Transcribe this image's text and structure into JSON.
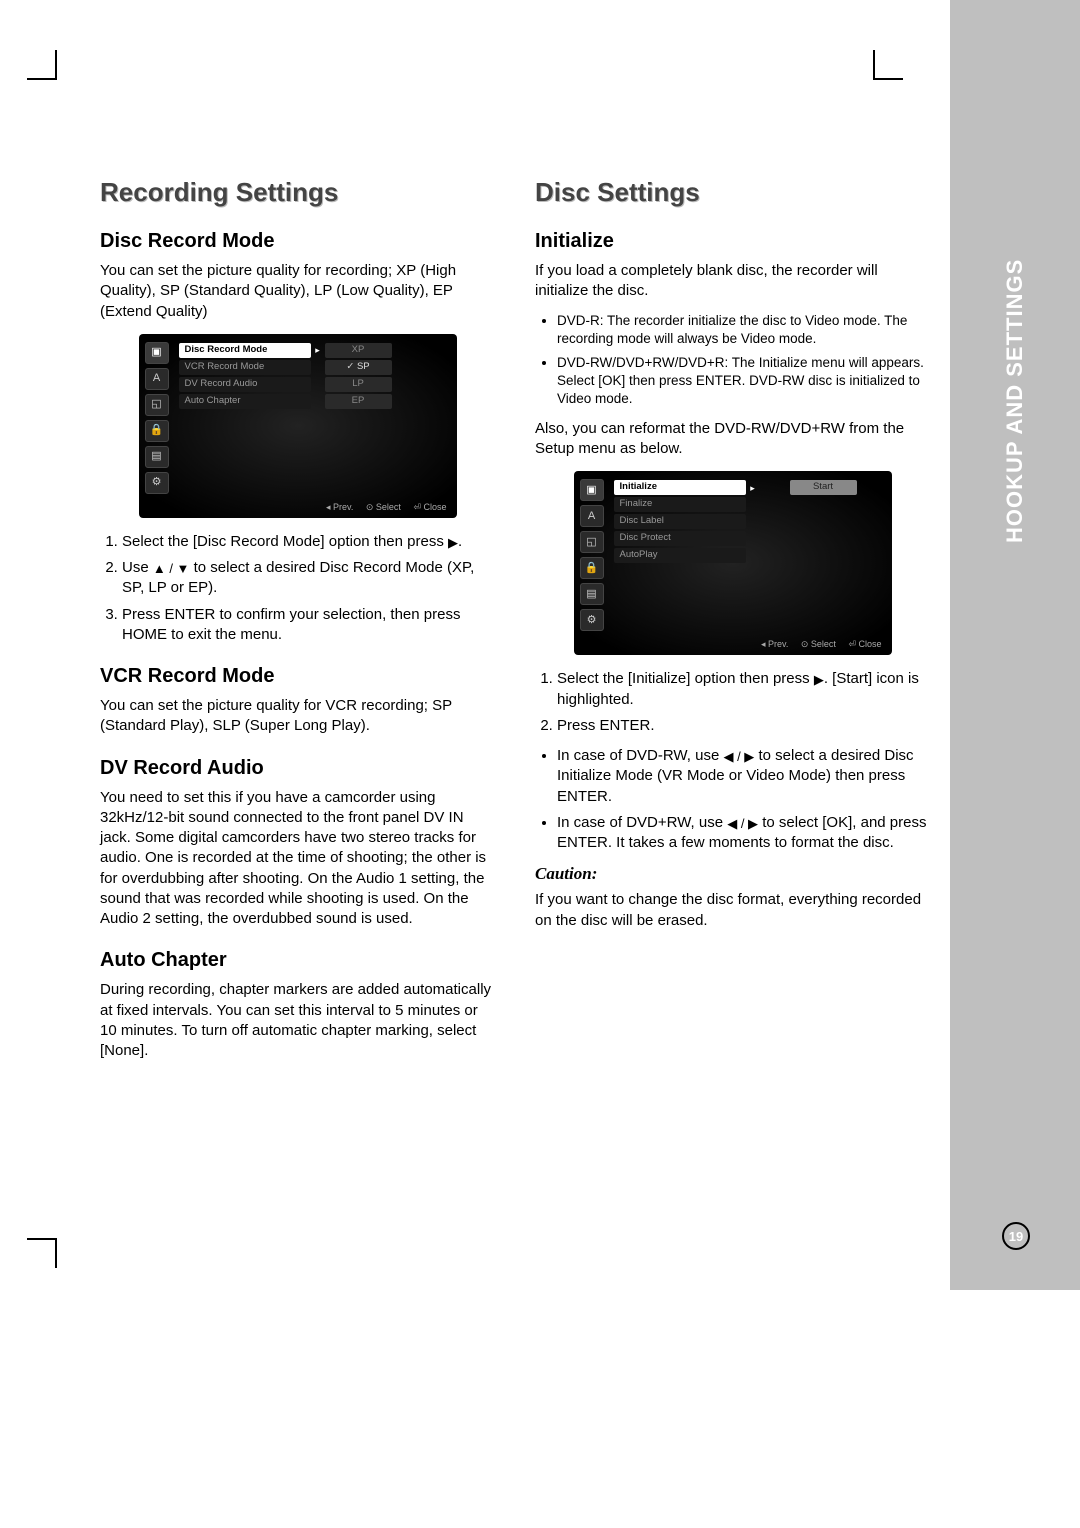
{
  "pageNumber": "19",
  "sideTab": "HOOKUP AND SETTINGS",
  "left": {
    "title": "Recording Settings",
    "sec1": {
      "heading": "Disc Record Mode",
      "p1": "You can set the picture quality for recording; XP (High Quality), SP (Standard Quality), LP (Low Quality), EP (Extend Quality)",
      "steps": {
        "s1a": "Select the [Disc Record Mode] option then press ",
        "s1b": ".",
        "s2a": "Use ",
        "s2b": " to select a desired Disc Record Mode (XP, SP, LP or EP).",
        "s3": "Press ENTER to confirm your selection, then press HOME to exit the menu."
      }
    },
    "sec2": {
      "heading": "VCR Record Mode",
      "p1": "You can set the picture quality for VCR recording; SP (Standard Play), SLP (Super Long Play)."
    },
    "sec3": {
      "heading": "DV Record Audio",
      "p1": "You need to set this if you have a camcorder using 32kHz/12-bit sound connected to the front panel DV IN jack. Some digital camcorders have two stereo tracks for audio. One is recorded at the time of shooting; the other is for overdubbing after shooting. On the Audio 1 setting, the sound that was recorded while shooting is used. On the Audio 2 setting, the overdubbed sound is used."
    },
    "sec4": {
      "heading": "Auto Chapter",
      "p1": "During recording, chapter markers are added automatically at fixed intervals. You can set this interval to 5 minutes or 10 minutes. To turn off automatic chapter marking, select [None]."
    }
  },
  "right": {
    "title": "Disc Settings",
    "sec1": {
      "heading": "Initialize",
      "p1": "If you load a completely blank disc, the recorder will initialize the disc.",
      "b1": "DVD-R: The recorder initialize the disc to Video mode. The recording mode will always be Video mode.",
      "b2": "DVD-RW/DVD+RW/DVD+R: The Initialize menu will appears. Select [OK] then press ENTER. DVD-RW disc is initialized to Video mode.",
      "p2": "Also, you can reformat the DVD-RW/DVD+RW from the Setup menu as below.",
      "steps": {
        "s1a": "Select the [Initialize] option then press ",
        "s1b": ". [Start] icon is highlighted.",
        "s2": "Press ENTER.",
        "s3a": "In case of DVD-RW, use ",
        "s3b": " to select a desired Disc Initialize Mode (VR Mode or Video Mode) then press ENTER.",
        "s4a": "In case of DVD+RW, use ",
        "s4b": " to select [OK], and press ENTER. It takes a few moments to format the disc."
      },
      "cautionHeading": "Caution:",
      "caution": "If you want to change the disc format, everything recorded on the disc will be erased."
    }
  },
  "osd1": {
    "items": {
      "i1": "Disc Record Mode",
      "i2": "VCR Record Mode",
      "i3": "DV Record Audio",
      "i4": "Auto Chapter"
    },
    "vals": {
      "v1": "XP",
      "v2": "SP",
      "v3": "LP",
      "v4": "EP"
    },
    "footer": {
      "prev": "◂ Prev.",
      "select": "⊙ Select",
      "close": "⏎ Close"
    }
  },
  "osd2": {
    "items": {
      "i1": "Initialize",
      "i2": "Finalize",
      "i3": "Disc Label",
      "i4": "Disc Protect",
      "i5": "AutoPlay"
    },
    "btn": "Start",
    "footer": {
      "prev": "◂ Prev.",
      "select": "⊙ Select",
      "close": "⏎ Close"
    }
  }
}
